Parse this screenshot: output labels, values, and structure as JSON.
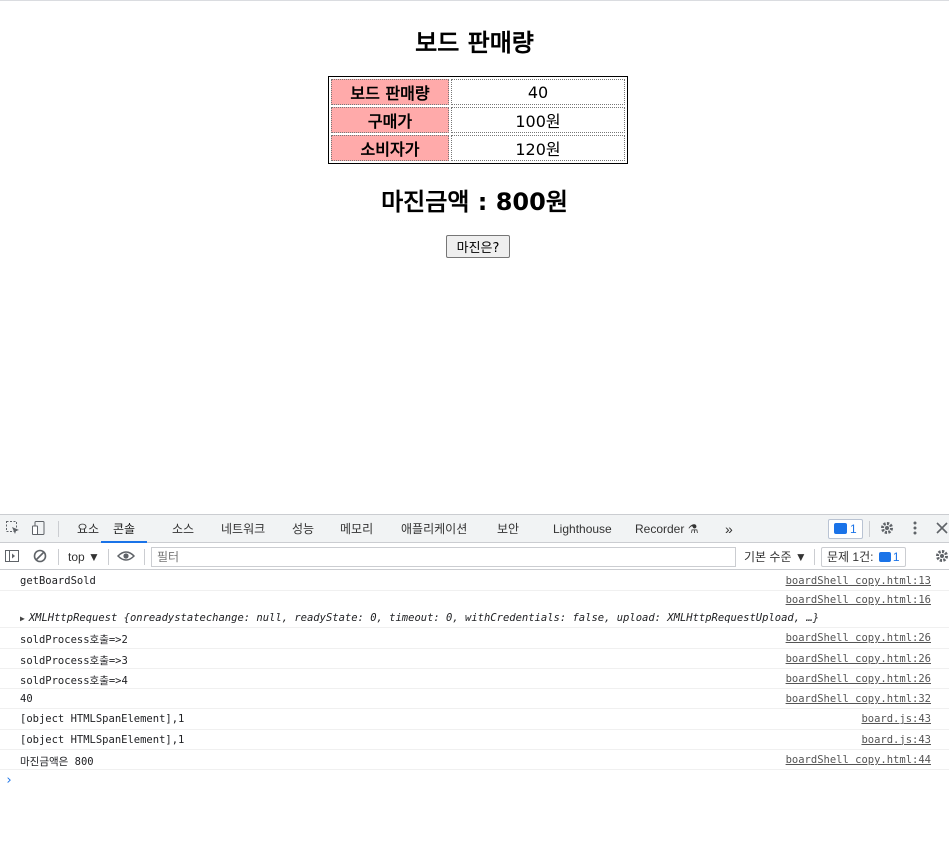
{
  "page": {
    "title": "보드 판매량",
    "table": [
      {
        "label": "보드 판매량",
        "value": "40"
      },
      {
        "label": "구매가",
        "value": "100원"
      },
      {
        "label": "소비자가",
        "value": "120원"
      }
    ],
    "margin_text": "마진금액 : 800원",
    "margin_button": "마진은?"
  },
  "devtools": {
    "tabs": [
      "요소",
      "콘솔",
      "소스",
      "네트워크",
      "성능",
      "메모리",
      "애플리케이션",
      "보안",
      "Lighthouse",
      "Recorder ⚗",
      "»"
    ],
    "active_tab": "콘솔",
    "issues_badge": "1",
    "filter_bar": {
      "context": "top ▼",
      "filter_placeholder": "필터",
      "levels": "기본 수준 ▼",
      "issues_label": "문제 1건:",
      "issues_count": "1"
    },
    "log": [
      {
        "msg": "getBoardSold",
        "src": "boardShell copy.html:13"
      },
      {
        "msg": "XMLHttpRequest {onreadystatechange: null, readyState: 0, timeout: 0, withCredentials: false, upload: XMLHttpRequestUpload, …}",
        "src": "boardShell copy.html:16"
      },
      {
        "msg": "soldProcess호출=>2",
        "src": "boardShell copy.html:26"
      },
      {
        "msg": "soldProcess호출=>3",
        "src": "boardShell copy.html:26"
      },
      {
        "msg": "soldProcess호출=>4",
        "src": "boardShell copy.html:26"
      },
      {
        "msg": "40",
        "src": "boardShell copy.html:32"
      },
      {
        "msg": "[object HTMLSpanElement],1",
        "src": "board.js:43"
      },
      {
        "msg": "[object HTMLSpanElement],1",
        "src": "board.js:43"
      },
      {
        "msg": "마진금액은 800",
        "src": "boardShell copy.html:44"
      }
    ],
    "prompt": "›"
  },
  "colors": {
    "table_header_bg": "#ffaaaa",
    "accent": "#1a73e8"
  }
}
